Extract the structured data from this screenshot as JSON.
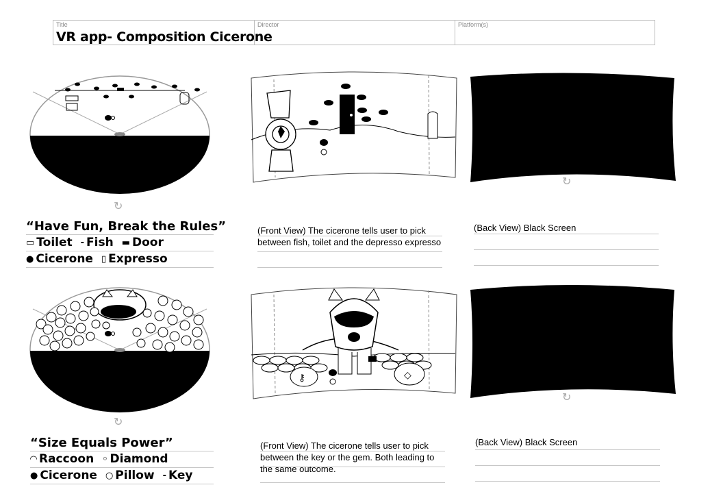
{
  "header": {
    "title_label": "Title",
    "title_value": "VR app- Composition Cicerone",
    "director_label": "Director",
    "platform_label": "Platform(s)"
  },
  "panel1": {
    "legend_title": "“Have Fun, Break the Rules”",
    "legend_rows": [
      [
        {
          "icon": "toilet-icon",
          "label": "Toilet"
        },
        {
          "icon": "fish-icon",
          "label": "Fish"
        },
        {
          "icon": "door-icon",
          "label": "Door"
        }
      ],
      [
        {
          "icon": "cicerone-icon",
          "label": "Cicerone"
        },
        {
          "icon": "expresso-icon",
          "label": "Expresso"
        }
      ]
    ],
    "front_caption": "(Front View) The cicerone tells user to pick between fish, toilet and the depresso expresso",
    "back_caption": "(Back View) Black Screen"
  },
  "panel2": {
    "legend_title": "“Size Equals Power”",
    "legend_rows": [
      [
        {
          "icon": "raccoon-icon",
          "label": "Raccoon"
        },
        {
          "icon": "diamond-icon",
          "label": "Diamond"
        }
      ],
      [
        {
          "icon": "cicerone-icon",
          "label": "Cicerone"
        },
        {
          "icon": "pillow-icon",
          "label": "Pillow"
        },
        {
          "icon": "key-icon",
          "label": "Key"
        }
      ]
    ],
    "front_caption": "(Front View) The cicerone tells user to pick between the key or the gem. Both leading to the same outcome.",
    "back_caption": "(Back View) Black Screen"
  }
}
